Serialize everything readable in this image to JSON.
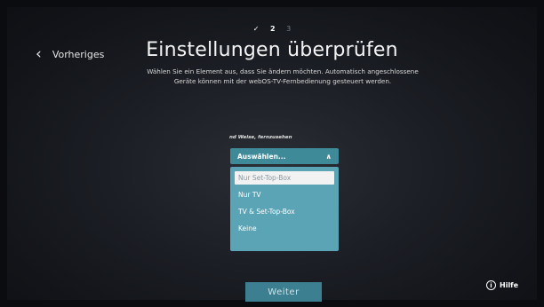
{
  "steps": {
    "done": "✓",
    "current": "2",
    "next": "3"
  },
  "nav": {
    "back_label": "Vorheriges"
  },
  "page": {
    "title": "Einstellungen überprüfen",
    "description_line1": "Wählen Sie ein Element aus, dass Sie ändern möchten. Automatisch angeschlossene",
    "description_line2": "Geräte können mit der webOS-TV-Fernbedienung gesteuert werden."
  },
  "field": {
    "label": "nd Weise, fernzusehen",
    "select_value": "Auswählen...",
    "options": [
      "Nur Set-Top-Box",
      "Nur TV",
      "TV & Set-Top-Box",
      "Keine"
    ],
    "focused_option_index": 0
  },
  "footer": {
    "next_label": "Weiter",
    "help_label": "Hilfe"
  },
  "colors": {
    "accent": "#3f8a98",
    "dropdown": "#5aa4b6",
    "button": "#3c7f90"
  }
}
